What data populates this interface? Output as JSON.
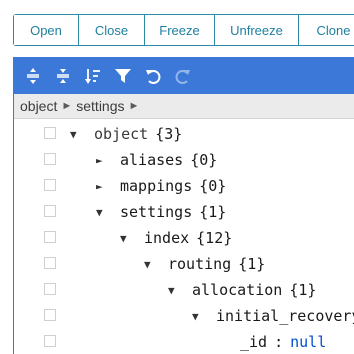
{
  "actions": {
    "open": "Open",
    "close": "Close",
    "freeze": "Freeze",
    "unfreeze": "Unfreeze",
    "clone": "Clone"
  },
  "menu": {
    "icons": [
      "expand-all-icon",
      "collapse-all-icon",
      "sort-icon",
      "filter-icon",
      "undo-icon",
      "redo-icon"
    ],
    "color": "#3c78d8"
  },
  "navbar": {
    "crumbs": [
      "object",
      "settings"
    ],
    "separator": "►"
  },
  "tree": {
    "toggle_expanded": "▼",
    "toggle_collapsed": "►",
    "rows": [
      {
        "key": "object",
        "count": "{3}",
        "expanded": true
      },
      {
        "key": "aliases",
        "count": "{0}",
        "expanded": false
      },
      {
        "key": "mappings",
        "count": "{0}",
        "expanded": false
      },
      {
        "key": "settings",
        "count": "{1}",
        "expanded": true
      },
      {
        "key": "index",
        "count": "{12}",
        "expanded": true
      },
      {
        "key": "routing",
        "count": "{1}",
        "expanded": true
      },
      {
        "key": "allocation",
        "count": "{1}",
        "expanded": true
      },
      {
        "key": "initial_recovery",
        "count": "{",
        "expanded": true
      },
      {
        "key": "_id",
        "colon": ":",
        "value": "null"
      }
    ]
  }
}
